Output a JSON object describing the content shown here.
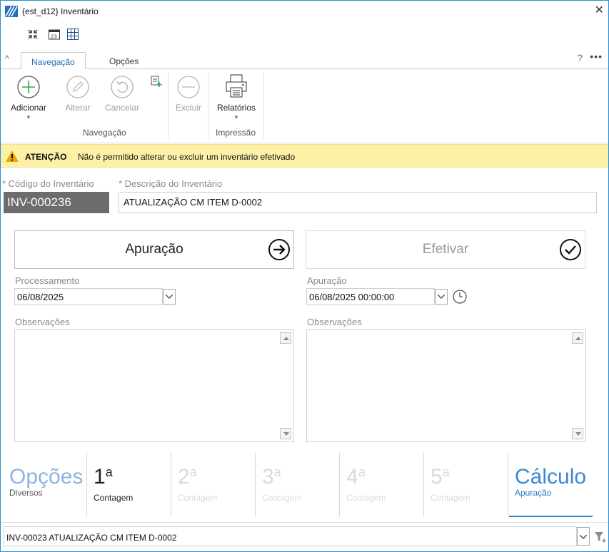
{
  "window": {
    "title": "{est_d12}  Inventário",
    "close_glyph": "✕"
  },
  "quick_access": [
    "collapse-arrows-icon",
    "calendar-icon",
    "grid-icon"
  ],
  "ribbon": {
    "collapse_glyph": "^",
    "tabs": [
      {
        "label": "Navegação",
        "active": true
      },
      {
        "label": "Opções",
        "active": false
      }
    ],
    "help": "?",
    "more": "•••",
    "groups": {
      "navegacao": {
        "label": "Navegação",
        "buttons": [
          {
            "label": "Adicionar",
            "icon": "plus-circle-icon",
            "enabled": true,
            "dropdown": true
          },
          {
            "label": "Alterar",
            "icon": "pencil-circle-icon",
            "enabled": false
          },
          {
            "label": "Cancelar",
            "icon": "undo-circle-icon",
            "enabled": false
          }
        ]
      },
      "excluir": {
        "label": "Excluir",
        "icon": "minus-circle-icon",
        "enabled": false
      },
      "impressao": {
        "label": "Impressão",
        "buttons": [
          {
            "label": "Relatórios",
            "icon": "printer-icon",
            "enabled": true,
            "dropdown": true
          }
        ]
      }
    },
    "arrow_glyph": "▼"
  },
  "warning": {
    "title": "ATENÇÃO",
    "text": "Não é permitido alterar ou excluir um inventário efetivado",
    "color": "#fdf1a8"
  },
  "form": {
    "code_label": "* Código do Inventário",
    "code_value": "INV-000236",
    "desc_label": "* Descrição do Inventário",
    "desc_value": "ATUALIZAÇÃO CM ITEM D-0002"
  },
  "actions": {
    "apuracao": {
      "label": "Apuração",
      "icon": "arrow-right-circle-icon"
    },
    "efetivar": {
      "label": "Efetivar",
      "icon": "check-circle-icon",
      "enabled": false
    }
  },
  "left_panel": {
    "date_label": "Processamento",
    "date_value": "06/08/2025",
    "obs_label": "Observações"
  },
  "right_panel": {
    "date_label": "Apuração",
    "date_value": "06/08/2025 00:00:00",
    "obs_label": "Observações"
  },
  "steps": [
    {
      "big": "Opções",
      "sup": "",
      "sub": "Diversos",
      "state": "options"
    },
    {
      "big": "1",
      "sup": "a",
      "sub": "Contagem",
      "state": "enabled"
    },
    {
      "big": "2",
      "sup": "a",
      "sub": "Contagem",
      "state": "disabled"
    },
    {
      "big": "3",
      "sup": "a",
      "sub": "Contagem",
      "state": "disabled"
    },
    {
      "big": "4",
      "sup": "a",
      "sub": "Contagem",
      "state": "disabled"
    },
    {
      "big": "5",
      "sup": "a",
      "sub": "Contagem",
      "state": "disabled"
    },
    {
      "big": "Cálculo",
      "sup": "",
      "sub": "Apuração",
      "state": "active"
    }
  ],
  "bottom": {
    "value": "INV-00023  ATUALIZAÇÃO CM ITEM D-0002",
    "filter_icon": "filter-icon"
  },
  "colors": {
    "accent": "#1e6fb9",
    "window_border": "#2a8dd4",
    "code_bg": "#6c6c6c",
    "green_plus": "#2aa84a"
  }
}
